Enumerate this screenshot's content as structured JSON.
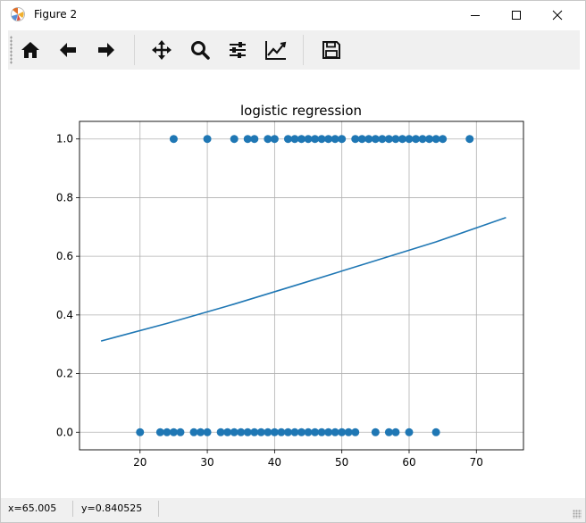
{
  "window": {
    "title": "Figure 2",
    "controls": [
      "minimize-icon",
      "maximize-icon",
      "close-icon"
    ]
  },
  "toolbar": {
    "items": [
      {
        "name": "home",
        "icon": "home-icon"
      },
      {
        "name": "back",
        "icon": "arrow-left-icon"
      },
      {
        "name": "forward",
        "icon": "arrow-right-icon"
      },
      {
        "name": "pan",
        "icon": "move-icon"
      },
      {
        "name": "zoom",
        "icon": "magnifier-icon"
      },
      {
        "name": "subplots",
        "icon": "sliders-icon"
      },
      {
        "name": "edit-axes",
        "icon": "line-chart-icon"
      },
      {
        "name": "save",
        "icon": "floppy-disk-icon"
      }
    ]
  },
  "status": {
    "x_text": "x=65.005",
    "y_text": "y=0.840525"
  },
  "chart_data": {
    "type": "scatter",
    "title": "logistic regression",
    "xlabel": "",
    "ylabel": "",
    "xlim": [
      11,
      77
    ],
    "ylim": [
      -0.06,
      1.06
    ],
    "xticks": [
      20,
      30,
      40,
      50,
      60,
      70
    ],
    "yticks": [
      0.0,
      0.2,
      0.4,
      0.6,
      0.8,
      1.0
    ],
    "grid": true,
    "color": "#1f77b4",
    "scatter_points": {
      "y1_x": [
        25,
        30,
        34,
        36,
        37,
        39,
        40,
        42,
        43,
        44,
        45,
        46,
        47,
        48,
        49,
        50,
        52,
        53,
        54,
        55,
        56,
        57,
        58,
        59,
        60,
        61,
        62,
        63,
        64,
        65,
        69
      ],
      "y0_x": [
        20,
        23,
        24,
        25,
        26,
        28,
        29,
        30,
        32,
        33,
        34,
        35,
        36,
        37,
        38,
        39,
        40,
        41,
        42,
        43,
        44,
        45,
        46,
        47,
        48,
        49,
        50,
        51,
        52,
        55,
        57,
        58,
        60,
        64
      ]
    },
    "line": {
      "x": [
        14.2,
        24,
        34,
        44,
        54,
        64,
        74.4
      ],
      "y": [
        0.311,
        0.371,
        0.437,
        0.507,
        0.578,
        0.649,
        0.732
      ]
    }
  }
}
